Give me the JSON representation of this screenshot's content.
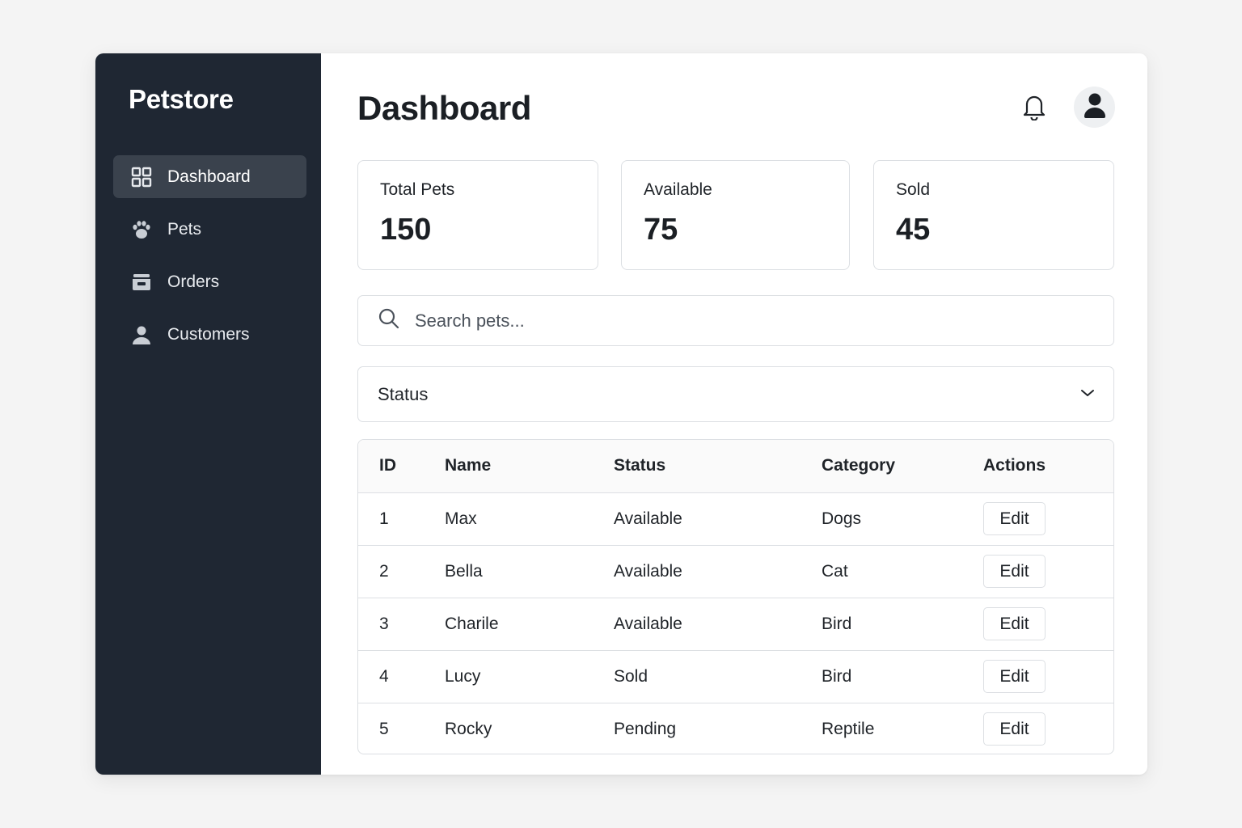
{
  "sidebar": {
    "brand": "Petstore",
    "items": [
      {
        "label": "Dashboard",
        "icon": "grid-icon",
        "active": true
      },
      {
        "label": "Pets",
        "icon": "paw-icon",
        "active": false
      },
      {
        "label": "Orders",
        "icon": "box-icon",
        "active": false
      },
      {
        "label": "Customers",
        "icon": "user-icon",
        "active": false
      }
    ]
  },
  "header": {
    "title": "Dashboard",
    "icons": [
      "bell-icon",
      "avatar-icon"
    ]
  },
  "stats": [
    {
      "label": "Total Pets",
      "value": "150"
    },
    {
      "label": "Available",
      "value": "75"
    },
    {
      "label": "Sold",
      "value": "45"
    }
  ],
  "search": {
    "placeholder": "Search pets..."
  },
  "filter": {
    "value": "Status"
  },
  "table": {
    "columns": [
      "ID",
      "Name",
      "Status",
      "Category",
      "Actions"
    ],
    "rows": [
      {
        "id": "1",
        "name": "Max",
        "status": "Available",
        "category": "Dogs",
        "action": "Edit"
      },
      {
        "id": "2",
        "name": "Bella",
        "status": "Available",
        "category": "Cat",
        "action": "Edit"
      },
      {
        "id": "3",
        "name": "Charile",
        "status": "Available",
        "category": "Bird",
        "action": "Edit"
      },
      {
        "id": "4",
        "name": "Lucy",
        "status": "Sold",
        "category": "Bird",
        "action": "Edit"
      },
      {
        "id": "5",
        "name": "Rocky",
        "status": "Pending",
        "category": "Reptile",
        "action": "Edit"
      }
    ]
  },
  "colors": {
    "sidebar_bg": "#1f2733",
    "sidebar_active": "#3a424d",
    "border": "#dcdfe3",
    "page_bg": "#f4f4f4"
  }
}
